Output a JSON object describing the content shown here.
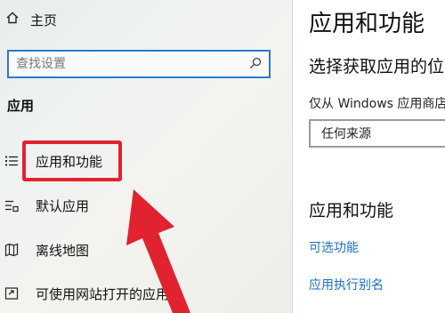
{
  "sidebar": {
    "home_label": "主页",
    "search_placeholder": "查找设置",
    "section_title": "应用",
    "items": [
      {
        "label": "应用和功能",
        "icon": "apps-list-icon",
        "selected": true
      },
      {
        "label": "默认应用",
        "icon": "default-apps-icon"
      },
      {
        "label": "离线地图",
        "icon": "map-icon"
      },
      {
        "label": "可使用网站打开的应用",
        "icon": "open-with-web-icon"
      }
    ]
  },
  "main": {
    "title": "应用和功能",
    "subtitle": "选择获取应用的位",
    "description": "仅从 Windows 应用商店",
    "dropdown_value": "任何来源",
    "section_heading": "应用和功能",
    "links": [
      "可选功能",
      "应用执行别名"
    ]
  },
  "colors": {
    "accent": "#2a7cc7",
    "highlight": "#e0232e",
    "link": "#1b6fc4"
  }
}
